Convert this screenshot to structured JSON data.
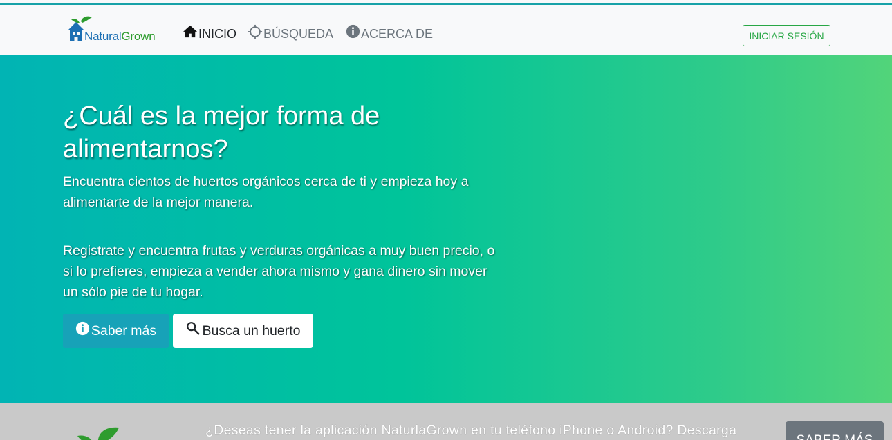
{
  "brand": {
    "logo_left": "Natural",
    "logo_right": "Grown"
  },
  "nav": {
    "items": [
      {
        "label": "INICIO",
        "icon": "home-icon",
        "active": true
      },
      {
        "label": "BÚSQUEDA",
        "icon": "crosshair-icon",
        "active": false
      },
      {
        "label": "ACERCA DE",
        "icon": "info-icon",
        "active": false
      }
    ],
    "login_label": "INICIAR SESIÓN"
  },
  "hero": {
    "title": "¿Cuál es la mejor forma de alimentarnos?",
    "paragraph_1": "Encuentra cientos de huertos orgánicos cerca de ti y empieza hoy a alimentarte de la mejor manera.",
    "paragraph_2": "Registrate y encuentra frutas y verduras orgánicas a muy buen precio, o si lo prefieres, empieza a vender ahora mismo y gana dinero sin mover un sólo pie de tu hogar.",
    "more_button": "Saber más",
    "search_button": "Busca un huerto"
  },
  "app_banner": {
    "text": "¿Deseas tener la aplicación NaturlaGrown en tu teléfono iPhone o Android? Descarga",
    "button": "SABER MÁS"
  },
  "colors": {
    "accent_line": "#17a2a8",
    "login_green": "#28a745",
    "info_button": "#17a2b8",
    "hero_gradient_start": "#01b4b4",
    "hero_gradient_end": "#52d47a",
    "banner_bg": "#c9c9c9",
    "secondary_button": "#6c757d"
  }
}
